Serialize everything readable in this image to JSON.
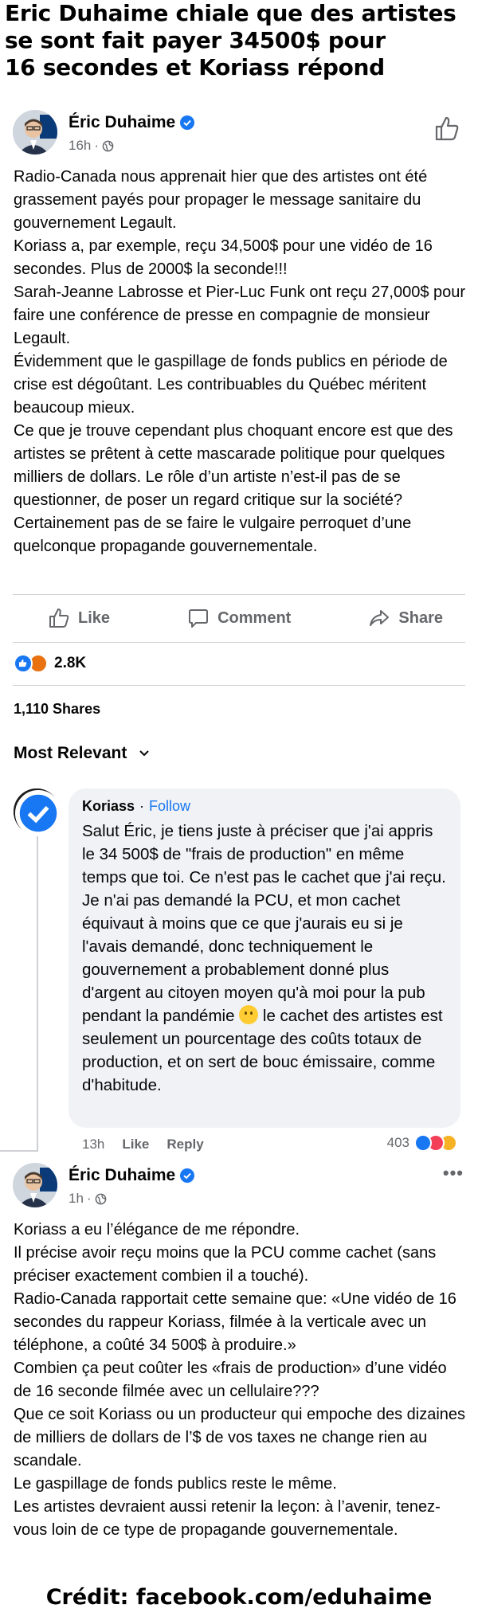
{
  "headline": {
    "line1": "Eric Duhaime chiale que des artistes",
    "line2": "se sont fait payer 34500$ pour",
    "line3": "16 secondes et Koriass répond"
  },
  "post": {
    "author": "Éric Duhaime",
    "time": "16h",
    "body": [
      "Radio-Canada nous apprenait hier que des artistes ont été grassement payés pour propager le message sanitaire du gouvernement Legault.",
      "Koriass a, par exemple, reçu 34,500$ pour une vidéo de 16 secondes. Plus de 2000$ la seconde!!!",
      "Sarah-Jeanne Labrosse et Pier-Luc Funk ont reçu 27,000$ pour faire une conférence de presse en compagnie de monsieur Legault.",
      "Évidemment que le gaspillage de fonds publics en période de crise est dégoûtant. Les contribuables du Québec méritent beaucoup mieux.",
      "Ce que je trouve cependant plus choquant encore est que des artistes se prêtent à cette mascarade politique pour quelques milliers de dollars. Le rôle d’un artiste n’est-il pas de se questionner, de poser un regard critique sur la société? Certainement pas de se faire le vulgaire perroquet d’une quelconque propagande gouvernementale."
    ],
    "actions": {
      "like": "Like",
      "comment": "Comment",
      "share": "Share"
    },
    "reaction_count": "2.8K",
    "shares": "1,110 Shares",
    "sort_label": "Most Relevant"
  },
  "comment": {
    "author": "Koriass",
    "follow": "Follow",
    "text_before_emoji": "Salut Éric, je tiens juste à préciser que j'ai appris le 34 500$ de \"frais de production\" en même temps que toi. Ce n'est pas le cachet que j'ai reçu. Je n'ai pas demandé la PCU, et mon cachet équivaut à moins que ce que j'aurais eu si je l'avais demandé, donc techniquement le gouvernement a probablement donné plus d'argent au citoyen moyen qu'à moi pour la pub pendant la pandémie",
    "text_after_emoji": " le cachet des artistes est seulement un pourcentage des coûts totaux de production, et on sert de bouc émissaire, comme d'habitude.",
    "time": "13h",
    "like": "Like",
    "reply": "Reply",
    "reaction_count": "403"
  },
  "reply_post": {
    "author": "Éric Duhaime",
    "time": "1h",
    "more": "•••",
    "body": [
      "Koriass a eu l’élégance de me répondre.",
      "Il précise avoir reçu moins que la PCU comme cachet (sans préciser exactement combien il a touché).",
      "Radio-Canada rapportait cette semaine que: «Une vidéo de 16 secondes du rappeur Koriass, filmée à la verticale avec un téléphone, a coûté 34 500$ à produire.»",
      "Combien ça peut coûter les «frais de production» d’une vidéo de 16 seconde filmée avec un cellulaire???",
      "Que ce soit Koriass ou un producteur qui empoche des dizaines de milliers de dollars de l’$ de vos taxes ne change rien au scandale.",
      "Le gaspillage de fonds publics reste le même.",
      "Les artistes devraient aussi retenir la leçon: à l’avenir, tenez-vous loin de ce type de propagande gouvernementale."
    ]
  },
  "credit": "Crédit: facebook.com/eduhaime",
  "colors": {
    "facebook_blue": "#1877f2",
    "secondary_text": "#65676b",
    "bubble_bg": "#f0f2f5"
  }
}
